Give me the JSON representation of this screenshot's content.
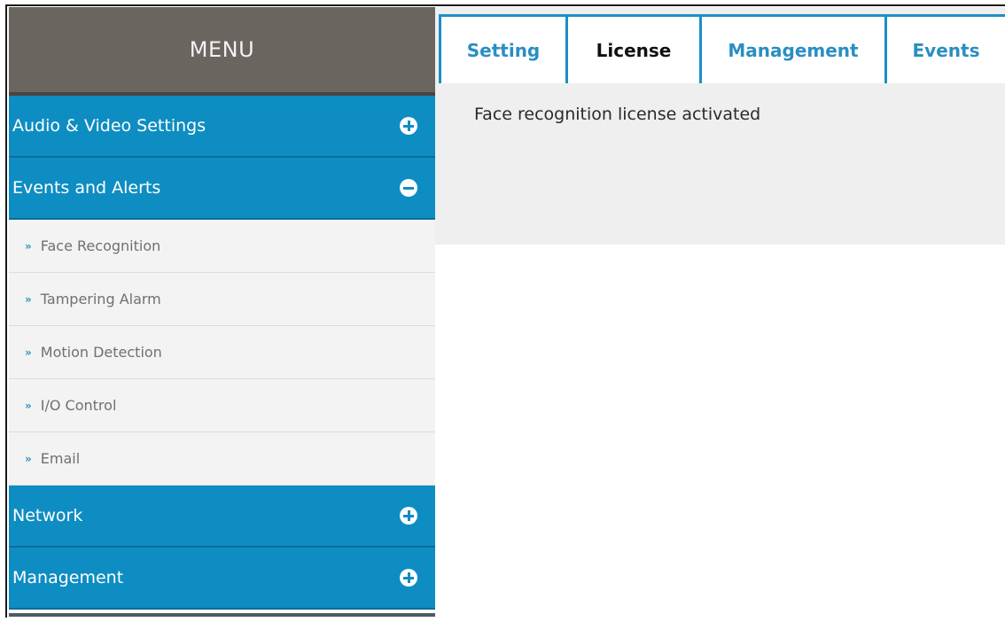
{
  "sidebar": {
    "title": "MENU",
    "categories": [
      {
        "label": "Audio & Video Settings",
        "toggle": "plus-icon"
      },
      {
        "label": "Events and Alerts",
        "toggle": "minus-icon"
      },
      {
        "label": "Network",
        "toggle": "plus-icon"
      },
      {
        "label": "Management",
        "toggle": "plus-icon"
      }
    ],
    "subitems": [
      {
        "arrow": "»",
        "label": "Face Recognition"
      },
      {
        "arrow": "»",
        "label": "Tampering Alarm"
      },
      {
        "arrow": "»",
        "label": "Motion Detection"
      },
      {
        "arrow": "»",
        "label": "I/O Control"
      },
      {
        "arrow": "»",
        "label": "Email"
      }
    ]
  },
  "tabs": [
    {
      "label": "Setting"
    },
    {
      "label": "License"
    },
    {
      "label": "Management"
    },
    {
      "label": "Events"
    }
  ],
  "active_tab": "License",
  "content": {
    "status_text": "Face recognition license activated"
  },
  "colors": {
    "accent": "#0e8dc2",
    "menu_header": "#6b6560",
    "content_bg": "#efefef"
  }
}
